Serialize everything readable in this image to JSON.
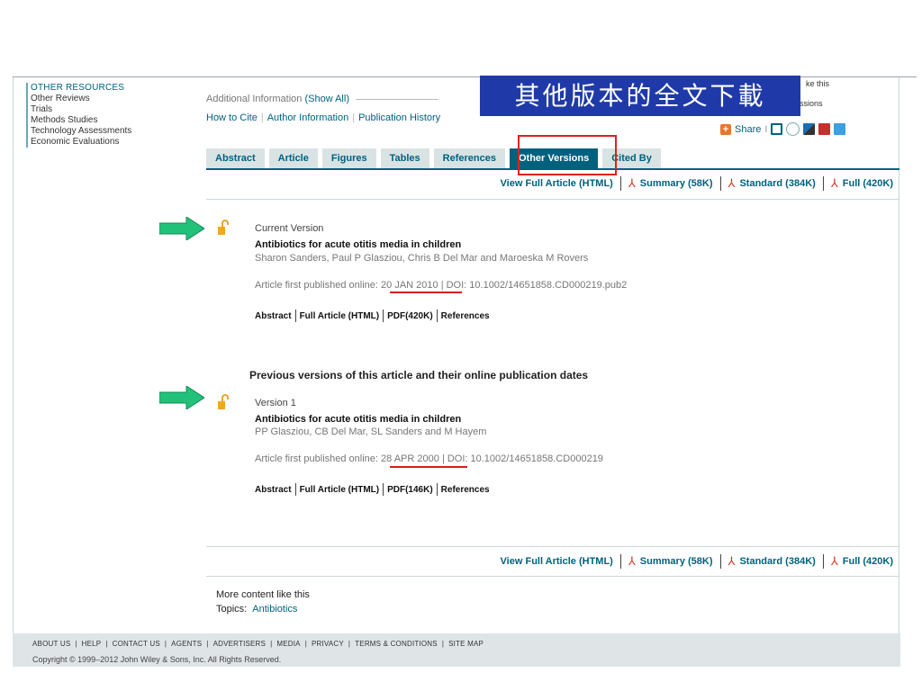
{
  "sidebar": {
    "heading": "OTHER RESOURCES",
    "items": [
      "Other Reviews",
      "Trials",
      "Methods Studies",
      "Technology Assessments",
      "Economic Evaluations"
    ]
  },
  "additional_info": {
    "label": "Additional Information",
    "toggle": "(Show All)"
  },
  "cite_links": [
    "How to Cite",
    "Author Information",
    "Publication History"
  ],
  "annotation": {
    "banner_text": "其他版本的全文下載"
  },
  "corner_fragments": [
    "ke this",
    "ssions"
  ],
  "share": {
    "label": "Share",
    "sep": "I"
  },
  "tabs": [
    "Abstract",
    "Article",
    "Figures",
    "Tables",
    "References",
    "Other Versions",
    "Cited By"
  ],
  "active_tab": "Other Versions",
  "view_links": {
    "html": "View Full Article (HTML)",
    "summary": "Summary (58K)",
    "standard": "Standard (384K)",
    "full": "Full (420K)"
  },
  "current_version": {
    "label": "Current Version",
    "title": "Antibiotics for acute otitis media in children",
    "authors": "Sharon Sanders, Paul P Glasziou, Chris B Del Mar and Maroeska M Rovers",
    "pub_prefix": "Article first published online:",
    "pub_date": "20 JAN 2010",
    "doi": "| DOI: 10.1002/14651858.CD000219.pub2",
    "links": [
      "Abstract",
      "Full Article (HTML)",
      "PDF(420K)",
      "References"
    ]
  },
  "previous_heading": "Previous versions of this article and their online publication dates",
  "version1": {
    "label": "Version 1",
    "title": "Antibiotics for acute otitis media in children",
    "authors": "PP Glasziou, CB Del Mar, SL Sanders and M Hayem",
    "pub_prefix": "Article first published online:",
    "pub_date": "28 APR 2000",
    "doi": "| DOI: 10.1002/14651858.CD000219",
    "links": [
      "Abstract",
      "Full Article (HTML)",
      "PDF(146K)",
      "References"
    ]
  },
  "more_content": {
    "heading": "More content like this",
    "topics_label": "Topics:",
    "topic": "Antibiotics"
  },
  "footer": {
    "nav": [
      "ABOUT US",
      "HELP",
      "CONTACT US",
      "AGENTS",
      "ADVERTISERS",
      "MEDIA",
      "PRIVACY",
      "TERMS & CONDITIONS",
      "SITE MAP"
    ],
    "copyright": "Copyright © 1999–2012 John Wiley & Sons, Inc. All Rights Reserved."
  },
  "colors": {
    "link": "#00617f",
    "tab_bg": "#d9e3e4",
    "active_tab": "#00617f",
    "banner": "#1f3aa8",
    "highlight": "#e0201c",
    "arrow": "#22c17a"
  }
}
